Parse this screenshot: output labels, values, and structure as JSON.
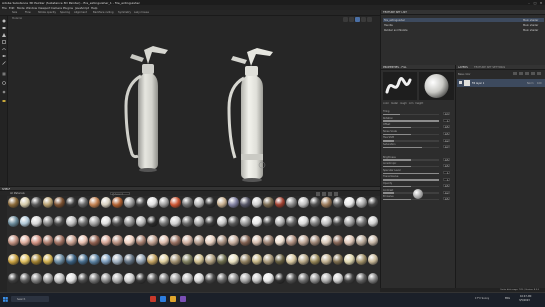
{
  "app": {
    "title": "Adobe Substance 3D Painter (Substance 3D Painter) - fire_extinguisher_1 - fire_extinguisher",
    "window_controls": [
      "–",
      "□",
      "✕"
    ]
  },
  "menu": [
    "File",
    "Edit",
    "Mode",
    "Window",
    "Viewport",
    "Camera",
    "Plugins",
    "JavaScript",
    "Help"
  ],
  "toolbar": {
    "items": [
      "Size",
      "Flow",
      "Stroke opacity",
      "Spacing",
      "Alignment",
      "Backface culling",
      "Symmetry",
      "Lazy mouse"
    ]
  },
  "viewport": {
    "label": "Material",
    "bg": "#262626",
    "icons": [
      "camera-icon",
      "light-icon",
      "screenshot-icon",
      "settings-icon",
      "grid-icon",
      "fullscreen-icon"
    ]
  },
  "texture_set_list": {
    "title": "TEXTURE SET LIST",
    "items": [
      {
        "name": "fire_extinguisher",
        "shader": "Main shader"
      },
      {
        "name": "Handle",
        "shader": "Main shader"
      },
      {
        "name": "Rubber and Nozzle",
        "shader": "Main shader"
      }
    ]
  },
  "properties": {
    "title": "PROPERTIES - FILL",
    "sections": [
      "Material",
      "Base color",
      "Roughness",
      "Metallic",
      "Height",
      "Normal",
      "Scale",
      "Height blend",
      "Details"
    ],
    "labels": [
      "color",
      "metal",
      "rough",
      "nrm",
      "height",
      "Tiling",
      "Rotation",
      "Offset",
      "Noise Scale",
      "Hue Shift",
      "Saturation",
      "Brightness",
      "Anisotropic",
      "Specular Level",
      "Transmissive",
      "Opacity",
      "Contrast",
      "Emissive"
    ],
    "values": [
      "0.5",
      "1",
      "0",
      "0.6",
      "1",
      "0.3",
      "1",
      "0.5",
      "0.5",
      "0.2",
      "0.7",
      "0.5",
      "0.5",
      "1",
      "1",
      "0.5",
      "0.2",
      "0.5"
    ],
    "preview_checked": "Preview"
  },
  "layers": {
    "title": "LAYERS",
    "tabs": [
      "LAYERS",
      "TEXTURE SET SETTINGS"
    ],
    "blend": "Base color",
    "items": [
      {
        "name": "Fill layer 1",
        "blend": "Norm",
        "opacity": "100"
      }
    ]
  },
  "shelf": {
    "title": "SHELF",
    "search_placeholder": "Search",
    "filter_label": "All Materials",
    "tab": "Materials",
    "swatch_colors": [
      [
        "#8a6a3a",
        "#d4c9a8",
        "#555555",
        "#b8a070",
        "#7a5030",
        "#3a3a3a",
        "#6a6a6a",
        "#c08050",
        "#d8d0c0",
        "#b06030",
        "#9a9a9a",
        "#444444",
        "#e0e0e0",
        "#a0a0a0",
        "#cc5533",
        "#707070",
        "#b8b8b8",
        "#303030",
        "#c8b090",
        "#8080a0",
        "#555566",
        "#d0d0d0",
        "#7a6a50",
        "#a04030",
        "#888888",
        "#c0c0c0",
        "#505050",
        "#9a7a5a",
        "#606060",
        "#e8e8e8",
        "#a8a8a8",
        "#484848"
      ],
      [
        "#6a8a9a",
        "#b0c8d8",
        "#d8d8d8",
        "#8a8a8a",
        "#4a4a4a",
        "#c0c0c0",
        "#707070",
        "#a0a0a0",
        "#e0e0e0",
        "#505050",
        "#909090",
        "#b8b8b8",
        "#2a2a2a",
        "#787878",
        "#d0d0d0",
        "#686868",
        "#a8a8a8",
        "#383838",
        "#c8c8c8",
        "#5a5a5a",
        "#989898",
        "#e8e8e8",
        "#404040",
        "#b0b0b0",
        "#606060",
        "#d8d8d8",
        "#808080",
        "#c0c0c0",
        "#484848",
        "#a0a0a0",
        "#707070",
        "#d0d0d0"
      ],
      [
        "#c09080",
        "#e0b0a0",
        "#d09080",
        "#b08070",
        "#a07060",
        "#c8a090",
        "#e8c0b0",
        "#906050",
        "#d8a898",
        "#b89080",
        "#f0d0c0",
        "#a88070",
        "#c0a090",
        "#e0c0b0",
        "#987060",
        "#d0b0a0",
        "#b8a090",
        "#e8d0c0",
        "#a89080",
        "#c8b0a0",
        "#806050",
        "#d8c0b0",
        "#9a8070",
        "#f0e0d0",
        "#b09080",
        "#c0a898",
        "#a08878",
        "#d8c8b8",
        "#886858",
        "#e0c8b8",
        "#b8a898",
        "#c8b8a8"
      ],
      [
        "#c8a040",
        "#e0c060",
        "#a08030",
        "#d0b050",
        "#6a8aa0",
        "#3a6080",
        "#4a7090",
        "#5a80a0",
        "#80a0c0",
        "#a0b0c0",
        "#607080",
        "#90a0b0",
        "#c0a060",
        "#e0d0a0",
        "#a09070",
        "#808060",
        "#d0c090",
        "#b0a080",
        "#707050",
        "#e8e0c0",
        "#908060",
        "#c8b888",
        "#a89878",
        "#686040",
        "#d8c8a0",
        "#b8a888",
        "#988858",
        "#c0b090",
        "#807050",
        "#e0d8b0",
        "#a09068",
        "#c8b898"
      ],
      [
        "#404040",
        "#606060",
        "#808080",
        "#a0a0a0",
        "#c0c0c0",
        "#e0e0e0",
        "#505050",
        "#707070",
        "#909090",
        "#b0b0b0",
        "#d0d0d0",
        "#383838",
        "#585858",
        "#787878",
        "#989898",
        "#b8b8b8",
        "#d8d8d8",
        "#484848",
        "#686868",
        "#888888",
        "#a8a8a8",
        "#c8c8c8",
        "#e8e8e8",
        "#303030",
        "#505050",
        "#707070",
        "#909090",
        "#b0b0b0",
        "#d0d0d0",
        "#404040",
        "#606060",
        "#808080"
      ]
    ]
  },
  "taskbar": {
    "search": "Search",
    "time": "10:47 AM",
    "date": "3/5/2023",
    "weather": "17°C Sunny",
    "lang": "ENG"
  },
  "status": {
    "text": "Cache disk usage: 70% | Version: 8.3.0"
  }
}
